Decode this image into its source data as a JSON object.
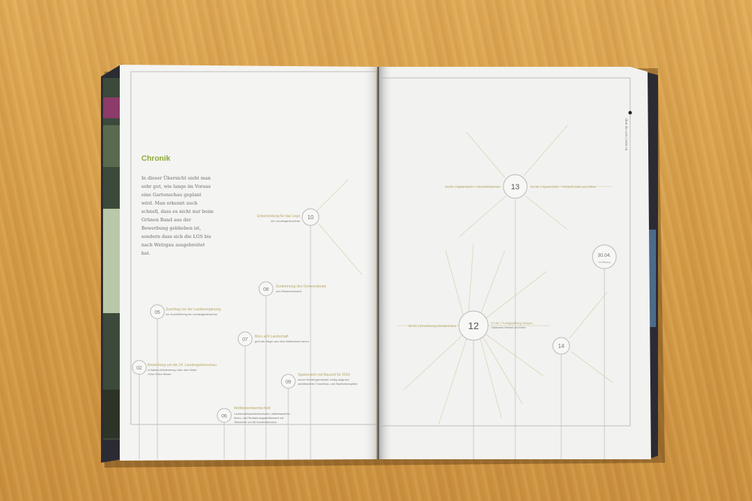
{
  "photo": {
    "description_free": true
  },
  "left_page": {
    "heading": "Chronik",
    "intro": "In dieser Übersicht sieht man sehr gut, wie lange im Voraus eine Gartenschau geplant wird. Man erkennt auch schnell, dass es nicht nur beim Grünen Band aus der Bewerbung geblieben ist, sondern dass sich die LGS bis nach Wetzgau ausgebreitet hat."
  },
  "right_page": {
    "side_label": "Über die LGS | Seite 15"
  },
  "markers": {
    "m02": "02",
    "m05": "05",
    "m06": "06",
    "m07": "07",
    "m08": "08",
    "m09": "09",
    "m10": "10",
    "m12": "12",
    "m13": "13",
    "m14": "14",
    "m_open": "30.04.",
    "m_open_sub": "Eröffnung"
  },
  "entries": {
    "e02_title": "Bewerbung um die 24. Landesgartenschau",
    "e02_line1": "in Baden-Württemberg unter dem Motto",
    "e02_line2": "»Das Grüne Band«",
    "e05_title": "Zuschlag vor der Landesregierung",
    "e05_line1": "zur Durchführung der Landesgartenschau",
    "e06_title": "Wettbewerbsentscheid",
    "e06_line1": "Landschaftsarchitektonischer, städtebaulicher",
    "e06_line2": "Ideen- und Realisierungswettbewerb mit",
    "e06_line3": "Teilnahme von 86 Architekturbüros",
    "e07_title": "Büro a24 Landschaft",
    "e07_line1": "geht als Sieger aus dem Wettbewerb hervor",
    "e08_title": "Zustimmung des Gemeinderats",
    "e08_line1": "zum Rahmenentwurf",
    "e09_title": "Spatenstich mit Bauzeit für 2014",
    "e09_line1": "durch Oberbürgermeister Leidig aufgrund",
    "e09_line2": "ambitionierter Tunnelbau- und Stadtumbaupläne",
    "e10_title": "Entscheidung für das Logo",
    "e10_line1": "der Landesgartenschau",
    "e12_left": "06.03. | Einweihung Krankenhaus",
    "e12_right": "17.05. | Fertigstellung Stegen",
    "e12_right_sub": "»Zwischen Himmel und Erde«",
    "e13_left": "04.03. | Spatenstich – Himmelsstürmer",
    "e13_right": "21.06. | Spatenstich – Parkteil Gold und Silber"
  },
  "colors": {
    "accent_green": "#8ea83a",
    "olive_text": "#b7a866",
    "line_gray": "#c9c9c9",
    "paper": "#f5f5f3",
    "wood": "#d9a14a"
  }
}
